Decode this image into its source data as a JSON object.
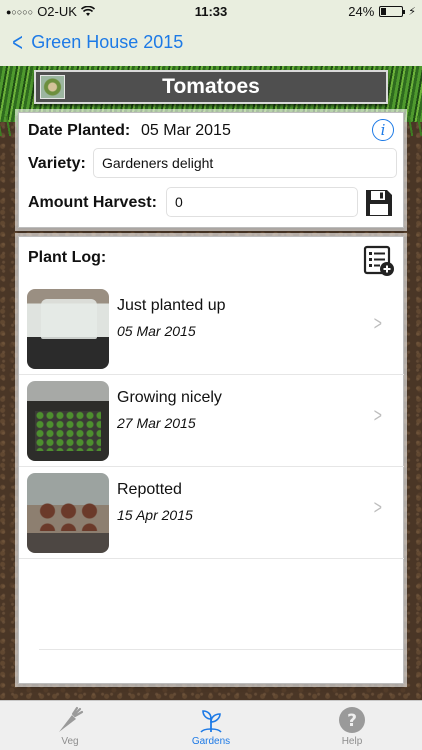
{
  "status_bar": {
    "carrier": "O2-UK",
    "signal_dots": "●○○○○",
    "time": "11:33",
    "battery_percent": "24%",
    "battery_level": 0.24
  },
  "nav": {
    "back_label": "Green House 2015"
  },
  "header": {
    "title": "Tomatoes"
  },
  "details": {
    "date_planted_label": "Date Planted:",
    "date_planted_value": "05 Mar 2015",
    "variety_label": "Variety:",
    "variety_value": "Gardeners delight",
    "amount_harvest_label": "Amount Harvest:",
    "amount_harvest_value": "0"
  },
  "log": {
    "title": "Plant Log:",
    "entries": [
      {
        "title": "Just planted up",
        "date": "05 Mar 2015"
      },
      {
        "title": "Growing nicely",
        "date": "27 Mar 2015"
      },
      {
        "title": "Repotted",
        "date": "15 Apr 2015"
      }
    ]
  },
  "tabs": [
    {
      "label": "Veg",
      "icon": "carrot-icon",
      "active": false
    },
    {
      "label": "Gardens",
      "icon": "seedling-icon",
      "active": true
    },
    {
      "label": "Help",
      "icon": "help-icon",
      "active": false
    }
  ],
  "colors": {
    "accent": "#1d7ae6",
    "title_bar": "#4f4f4f",
    "nav_bg": "#e9eedf"
  }
}
